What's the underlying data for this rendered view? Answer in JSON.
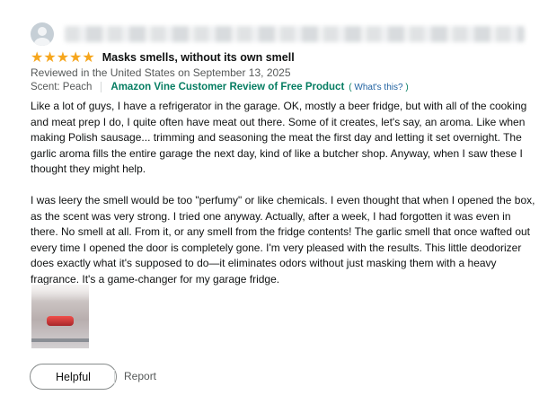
{
  "review": {
    "reviewer_name_hidden": true,
    "rating": 5,
    "title": "Masks smells, without its own smell",
    "meta": "Reviewed in the United States on September 13, 2025",
    "scent": "Scent: Peach",
    "vine_label": "Amazon Vine Customer Review of Free Product",
    "whats_this_open": "(",
    "whats_this_link": "What's this?",
    "whats_this_close": ")",
    "paragraphs": [
      "Like a lot of guys, I have a refrigerator in the garage. OK, mostly a beer fridge, but with all of the cooking and meat prep I do, I quite often have meat out there. Some of it creates, let's say, an aroma. Like when making Polish sausage... trimming and seasoning the meat the first day and letting it set overnight. The garlic aroma fills the entire garage the next day, kind of like a butcher shop. Anyway, when I saw these I thought they might help.",
      "I was leery the smell would be too \"perfumy\" or like chemicals. I even thought that when I opened the box, as the scent was very strong. I tried one anyway. Actually, after a week, I had forgotten it was even in there. No smell at all. From it, or any smell from the fridge contents! The garlic smell that once wafted out every time I opened the door is completely gone. I'm very pleased with the results. This little deodorizer does exactly what it's supposed to do—it eliminates odors without just masking them with a heavy fragrance. It's a game-changer for my garage fridge."
    ]
  },
  "actions": {
    "helpful_label": "Helpful",
    "report_label": "Report"
  },
  "colors": {
    "star": "#f6a61d",
    "vine_green": "#067d62",
    "link_blue": "#2162a1",
    "muted_text": "#565959"
  }
}
